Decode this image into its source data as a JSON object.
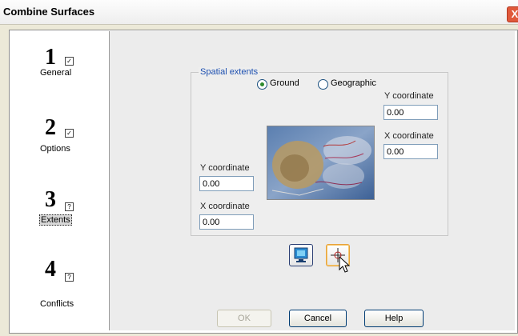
{
  "window": {
    "title": "Combine Surfaces",
    "close_glyph": "X"
  },
  "steps": [
    {
      "number": "1",
      "mark": "✓",
      "label": "General",
      "active": false
    },
    {
      "number": "2",
      "mark": "✓",
      "label": "Options",
      "active": false
    },
    {
      "number": "3",
      "mark": "?",
      "label": "Extents",
      "active": true
    },
    {
      "number": "4",
      "mark": "?",
      "label": "Conflicts",
      "active": false
    }
  ],
  "extents": {
    "group_label": "Spatial extents",
    "radio_ground": "Ground",
    "radio_geographic": "Geographic",
    "selected": "Ground",
    "upper_right": {
      "y_label": "Y coordinate",
      "y_value": "0.00",
      "x_label": "X coordinate",
      "x_value": "0.00"
    },
    "lower_left": {
      "y_label": "Y coordinate",
      "y_value": "0.00",
      "x_label": "X coordinate",
      "x_value": "0.00"
    }
  },
  "tools": {
    "view_icon": "zoom-extent-icon",
    "pick_icon": "crosshair-pick-icon"
  },
  "buttons": {
    "ok": "OK",
    "cancel": "Cancel",
    "help": "Help"
  },
  "colors": {
    "accent": "#1c4fb0",
    "window_bg": "#ece9d8"
  }
}
